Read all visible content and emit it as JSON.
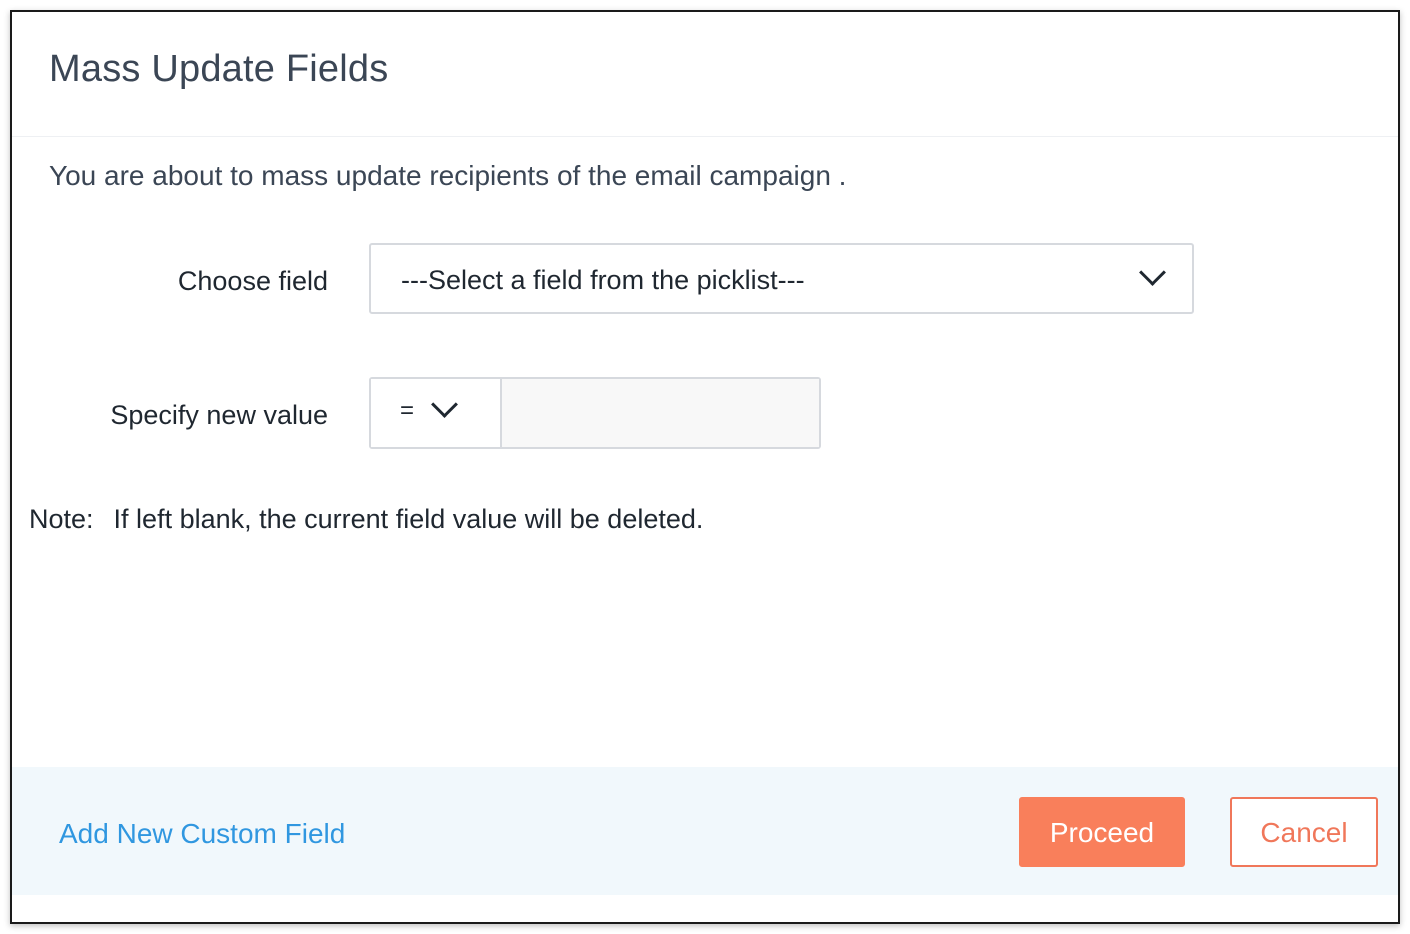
{
  "dialog": {
    "title": "Mass Update Fields",
    "intro": "You are about to mass update recipients of the email campaign ."
  },
  "form": {
    "choose_field_label": "Choose field",
    "choose_field_selected": "---Select a field from the picklist---",
    "specify_value_label": "Specify new value",
    "operator_selected": "=",
    "value_input": ""
  },
  "note": {
    "label": "Note:",
    "text": "If left blank, the current field value will be deleted."
  },
  "footer": {
    "add_custom_field_link": "Add New Custom Field",
    "proceed_label": "Proceed",
    "cancel_label": "Cancel"
  },
  "icons": {
    "dropdown": "chevron-down-icon"
  },
  "colors": {
    "primary_button": "#f97f5b",
    "cancel_border": "#f0775a",
    "link": "#3097e0",
    "footer_bg": "#f1f8fc",
    "title_text": "#3b4655"
  }
}
